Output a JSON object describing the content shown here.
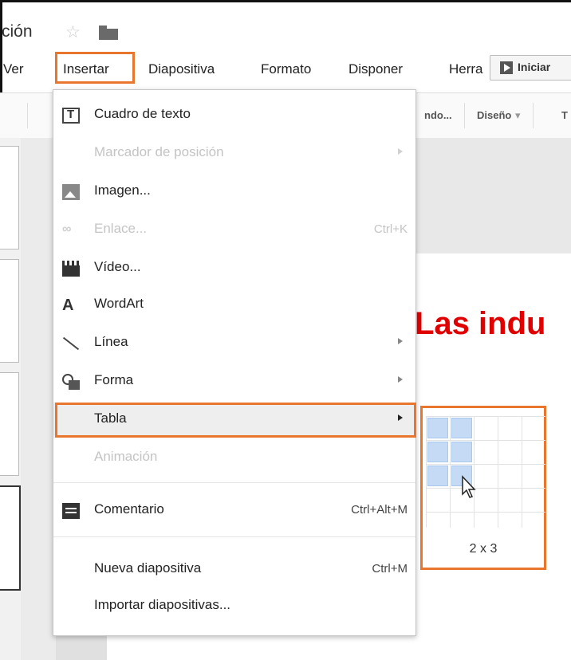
{
  "app": {
    "doc_title": "ción",
    "star_icon": "star-icon",
    "folder_icon": "folder-icon"
  },
  "menubar": {
    "items": [
      "Ver",
      "Insertar",
      "Diapositiva",
      "Formato",
      "Disponer",
      "Herra"
    ],
    "present_label": "Iniciar"
  },
  "toolbar": {
    "background_label": "ndo...",
    "layout_label": "Diseño",
    "more_label": "T"
  },
  "slide": {
    "title": "Las indu"
  },
  "insert_menu": {
    "items": [
      {
        "label": "Cuadro de texto",
        "icon": "textbox-icon"
      },
      {
        "label": "Marcador de posición",
        "disabled": true,
        "submenu": true
      },
      {
        "label": "Imagen...",
        "icon": "image-icon"
      },
      {
        "label": "Enlace...",
        "shortcut": "Ctrl+K",
        "icon": "link-icon",
        "disabled": true
      },
      {
        "label": "Vídeo...",
        "icon": "video-icon"
      },
      {
        "label": "WordArt",
        "icon": "wordart-icon"
      },
      {
        "label": "Línea",
        "icon": "line-icon",
        "submenu": true
      },
      {
        "label": "Forma",
        "icon": "shape-icon",
        "submenu": true
      },
      {
        "label": "Tabla",
        "submenu": true,
        "highlighted": true
      },
      {
        "label": "Animación",
        "disabled": true
      },
      {
        "label": "Comentario",
        "shortcut": "Ctrl+Alt+M",
        "icon": "comment-icon"
      },
      {
        "label": "Nueva diapositiva",
        "shortcut": "Ctrl+M"
      },
      {
        "label": "Importar diapositivas..."
      }
    ]
  },
  "table_picker": {
    "size_label": "2 x 3",
    "selected_columns": 2,
    "selected_rows": 3
  },
  "colors": {
    "highlight_box": "#e8762d",
    "slide_title": "#e00000",
    "grid_selected": "#c5dbf5"
  }
}
